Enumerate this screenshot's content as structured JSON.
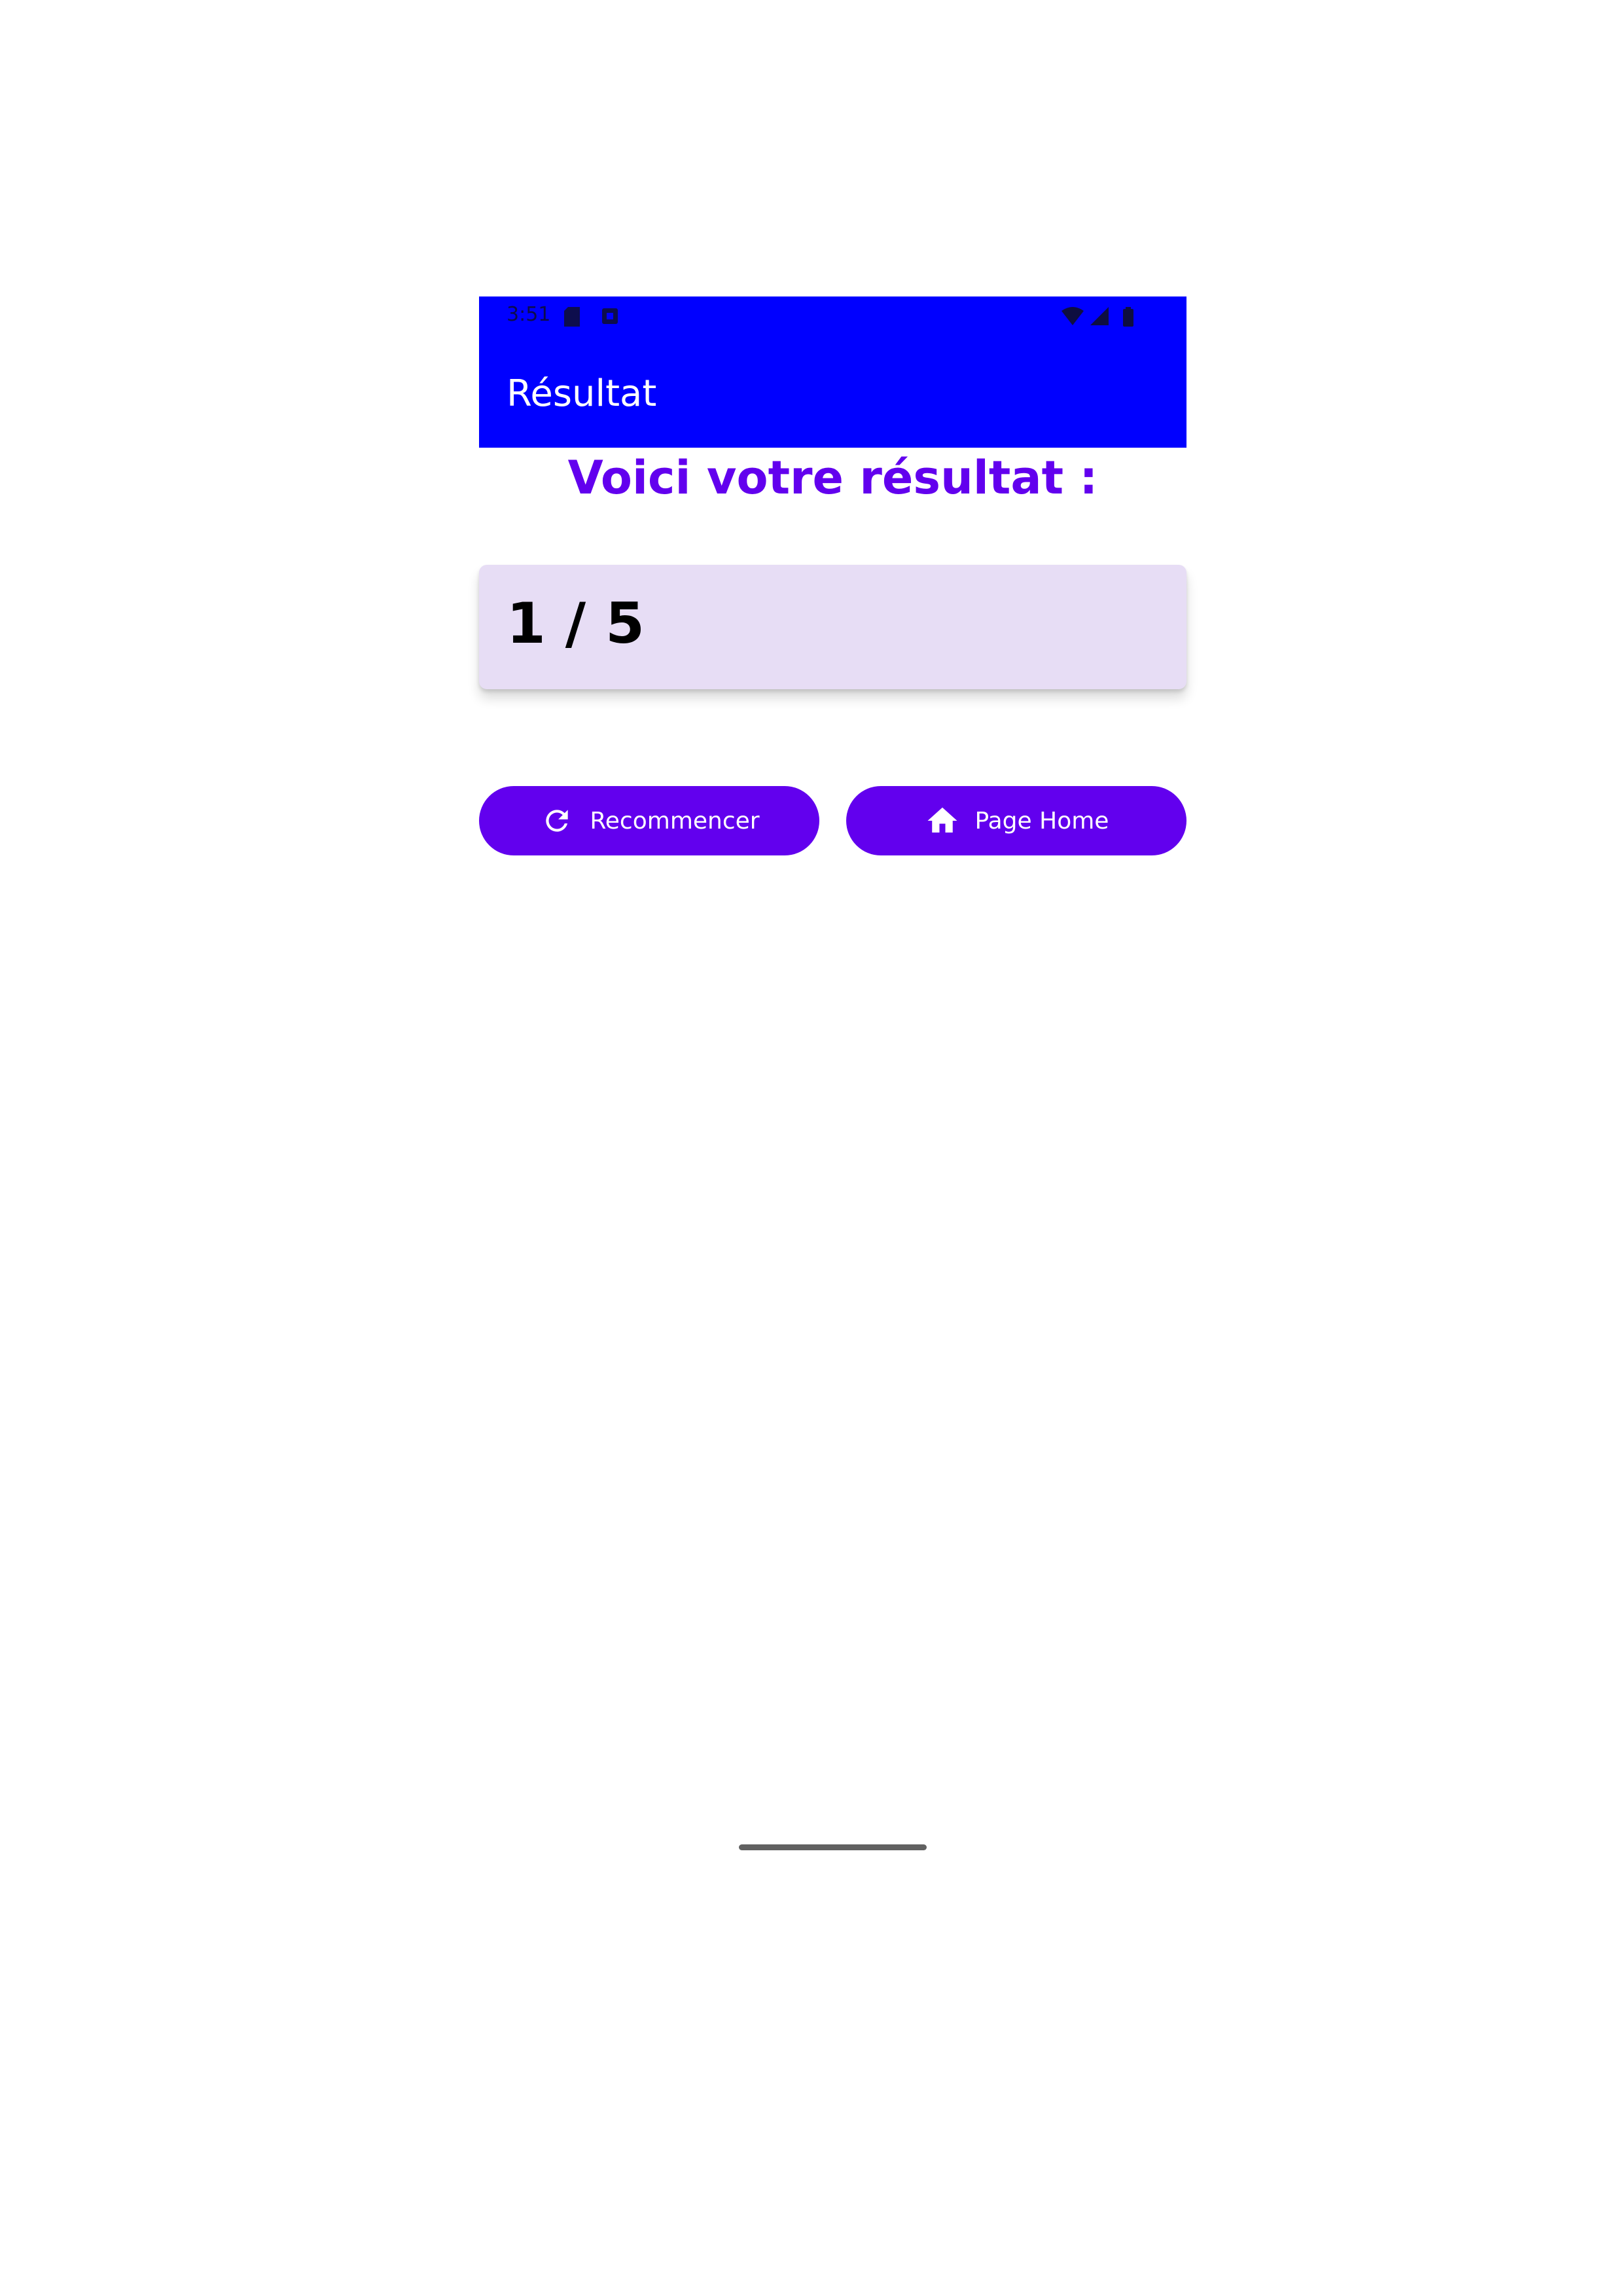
{
  "status_bar": {
    "time": "3:51",
    "icons": [
      "sim-card-icon",
      "notification-icon",
      "wifi-icon",
      "signal-icon",
      "battery-icon"
    ]
  },
  "appbar": {
    "title": "Résultat",
    "color": "#0000ff"
  },
  "main": {
    "heading": "Voici votre résultat :",
    "score": "1 / 5",
    "heading_color": "#6200ee",
    "card_color": "#e7ddf5"
  },
  "buttons": {
    "restart": {
      "label": "Recommencer",
      "icon": "refresh-icon"
    },
    "home": {
      "label": "Page Home",
      "icon": "home-icon"
    },
    "color": "#6200ee"
  }
}
